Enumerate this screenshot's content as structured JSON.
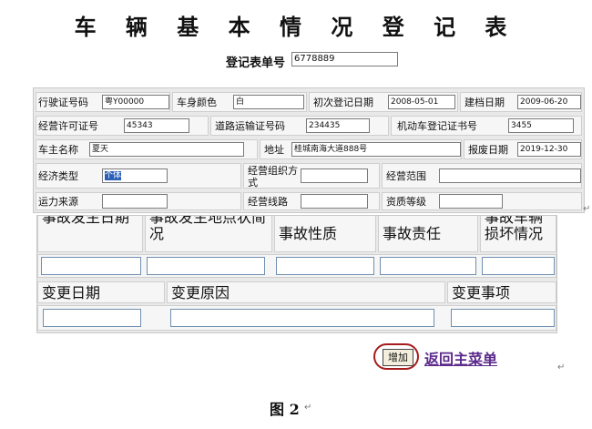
{
  "title": "车 辆 基 本 情 况 登 记 表",
  "reg_no": {
    "label": "登记表单号",
    "value": "6778889"
  },
  "fields": {
    "license_no": {
      "label": "行驶证号码",
      "value": "粤Y00000"
    },
    "color": {
      "label": "车身颜色",
      "value": "白"
    },
    "first_reg": {
      "label": "初次登记日期",
      "value": "2008-05-01"
    },
    "archive_date": {
      "label": "建档日期",
      "value": "2009-06-20"
    },
    "permit_no": {
      "label": "经营许可证号",
      "value": "45343"
    },
    "road_cert": {
      "label": "道路运输证号码",
      "value": "234435"
    },
    "vehicle_reg_cert": {
      "label": "机动车登记证书号",
      "value": "3455"
    },
    "owner": {
      "label": "车主名称",
      "value": "夏天"
    },
    "address": {
      "label": "地址",
      "value": "桂城南海大道888号"
    },
    "scrap_date": {
      "label": "报废日期",
      "value": "2019-12-30"
    },
    "econ_type": {
      "label": "经济类型",
      "value": "个体"
    },
    "org_mode": {
      "label": "经营组织方式",
      "value": ""
    },
    "scope": {
      "label": "经营范围",
      "value": ""
    },
    "capacity_source": {
      "label": "运力来源",
      "value": ""
    },
    "route": {
      "label": "经营线路",
      "value": ""
    },
    "qualification": {
      "label": "资质等级",
      "value": ""
    }
  },
  "accident": {
    "col1": "事故发生日期",
    "col2": "事故发生地点状简况",
    "col3": "事故性质",
    "col4": "事故责任",
    "col5": "事故车辆损坏情况"
  },
  "change": {
    "col1": "变更日期",
    "col2": "变更原因",
    "col3": "变更事项"
  },
  "add_button": "增加",
  "back_link": "返回主菜单",
  "caption": "图 2",
  "para_mark": "↵"
}
